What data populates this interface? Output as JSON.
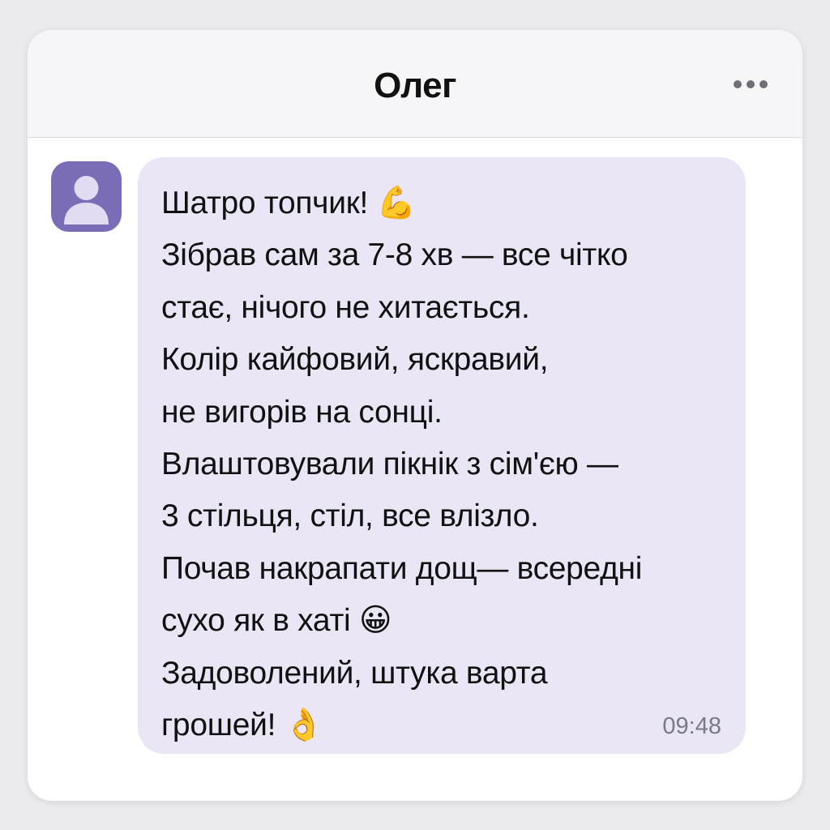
{
  "header": {
    "contact_name": "Олег",
    "more_icon": "more-horizontal-icon"
  },
  "avatar": {
    "icon": "user-icon",
    "color": "#7c6bb7"
  },
  "message": {
    "text": "Шатро топчик! 💪\nЗібрав сам за 7-8 хв — все чітко\nстає, нічого не хитається.\nКолір кайфовий, яскравий,\nне вигорів на сонці.\nВлаштовували пікнік з сім'єю —\n3 стільця, стіл, все влізло.\nПочав накрапати дощ— всередні\nсухо як в хаті 😀\nЗадоволений, штука варта\nгрошей! 👌",
    "time": "09:48",
    "bubble_color": "#eae6f5"
  }
}
